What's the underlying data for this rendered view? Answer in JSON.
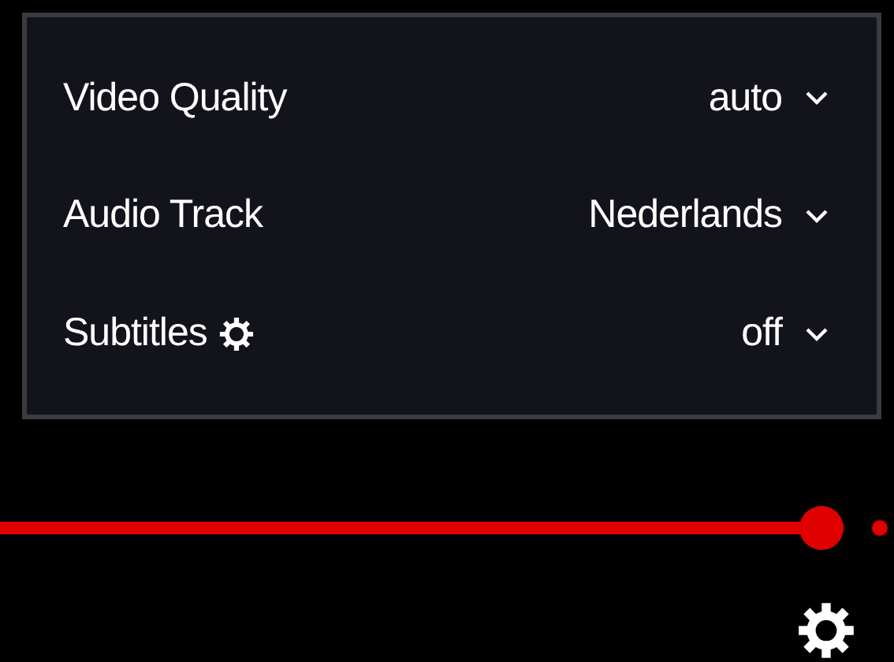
{
  "settings_menu": {
    "rows": [
      {
        "label": "Video Quality",
        "value": "auto",
        "settings_icon": false
      },
      {
        "label": "Audio Track",
        "value": "Nederlands",
        "settings_icon": false
      },
      {
        "label": "Subtitles",
        "value": "off",
        "settings_icon": true
      }
    ]
  },
  "progress": {
    "level": 0.95
  }
}
